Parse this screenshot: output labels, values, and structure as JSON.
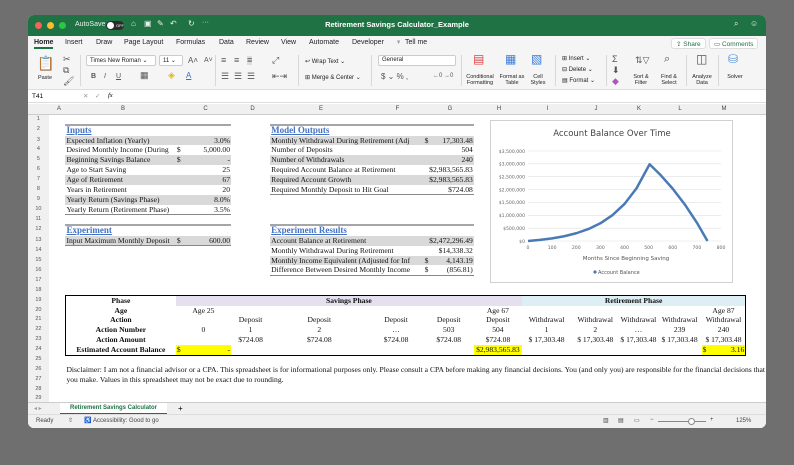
{
  "titlebar": {
    "autosave_label": "AutoSave",
    "autosave_state": "OFF",
    "title": "Retirement Savings Calculator_Example"
  },
  "menu": {
    "tabs": [
      "Home",
      "Insert",
      "Draw",
      "Page Layout",
      "Formulas",
      "Data",
      "Review",
      "View",
      "Automate",
      "Developer",
      "Tell me"
    ],
    "share": "Share",
    "comments": "Comments"
  },
  "ribbon": {
    "paste": "Paste",
    "font_name": "Times New Roman",
    "font_size": "11",
    "wrap_text": "Wrap Text",
    "merge_center": "Merge & Center",
    "number_format": "General",
    "conditional_formatting": "Conditional Formatting",
    "format_as_table": "Format as Table",
    "cell_styles": "Cell Styles",
    "insert": "Insert",
    "delete": "Delete",
    "format": "Format",
    "sort_filter": "Sort & Filter",
    "find_select": "Find & Select",
    "analyze_data": "Analyze Data",
    "solver": "Solver"
  },
  "formula_bar": {
    "name_box": "T41",
    "fx": "fx",
    "value": ""
  },
  "columns": [
    "A",
    "B",
    "C",
    "D",
    "E",
    "F",
    "G",
    "H",
    "I",
    "J",
    "K",
    "L",
    "M"
  ],
  "rows": [
    "1",
    "2",
    "3",
    "4",
    "5",
    "6",
    "7",
    "8",
    "9",
    "10",
    "11",
    "12",
    "13",
    "14",
    "15",
    "16",
    "17",
    "18",
    "19",
    "20",
    "21",
    "22",
    "23",
    "24",
    "25",
    "26",
    "27",
    "28",
    "29"
  ],
  "inputs": {
    "title": "Inputs",
    "rows": [
      {
        "label": "Expected Inflation (Yearly)",
        "cur": "",
        "value": "3.0%"
      },
      {
        "label": "Desired Monthly Income (During",
        "cur": "$",
        "value": "5,000.00"
      },
      {
        "label": "Beginning Savings Balance",
        "cur": "$",
        "value": "-"
      },
      {
        "label": "Age to Start Saving",
        "cur": "",
        "value": "25"
      },
      {
        "label": "Age of Retirement",
        "cur": "",
        "value": "67"
      },
      {
        "label": "Years in Retirement",
        "cur": "",
        "value": "20"
      },
      {
        "label": "Yearly Return (Savings Phase)",
        "cur": "",
        "value": "8.0%"
      },
      {
        "label": "Yearly Return (Retirement Phase)",
        "cur": "",
        "value": "3.5%"
      }
    ]
  },
  "outputs": {
    "title": "Model Outputs",
    "rows": [
      {
        "label": "Monthly Withdrawal During Retirement (Adj",
        "cur": "$",
        "value": "17,303.48"
      },
      {
        "label": "Number of Deposits",
        "cur": "",
        "value": "504"
      },
      {
        "label": "Number of Withdrawals",
        "cur": "",
        "value": "240"
      },
      {
        "label": "Required Account Balance at Retirement",
        "cur": "",
        "value": "$2,983,565.83"
      },
      {
        "label": "Required Account Growth",
        "cur": "",
        "value": "$2,983,565.83"
      },
      {
        "label": "Required Monthly Deposit to Hit Goal",
        "cur": "",
        "value": "$724.08"
      }
    ]
  },
  "experiment": {
    "title": "Experiment",
    "rows": [
      {
        "label": "Input Maximum Monthly Deposit",
        "cur": "$",
        "value": "600.00"
      }
    ]
  },
  "experiment_results": {
    "title": "Experiment Results",
    "rows": [
      {
        "label": "Account Balance at Retirement",
        "cur": "",
        "value": "$2,472,296.49"
      },
      {
        "label": "Monthly Withdrawal During Retirement",
        "cur": "",
        "value": "$14,338.32"
      },
      {
        "label": "Monthly Income Equivalent (Adjusted for Inf",
        "cur": "$",
        "value": "4,143.19"
      },
      {
        "label": "Difference Between Desired Monthly Income",
        "cur": "$",
        "value": "(856.81)"
      }
    ]
  },
  "phase_table": {
    "labels": [
      "Phase",
      "Age",
      "Action",
      "Action Number",
      "Action Amount",
      "Estimated Account Balance"
    ],
    "savings_phase": "Savings Phase",
    "retirement_phase": "Retirement Phase",
    "ages": {
      "C": "Age 25",
      "H": "Age 67",
      "M": "Age 87"
    },
    "actions": [
      "",
      "Deposit",
      "Deposit",
      "Deposit",
      "Deposit",
      "Deposit",
      "Withdrawal",
      "Withdrawal",
      "Withdrawal",
      "Withdrawal",
      "Withdrawal"
    ],
    "numbers": [
      "0",
      "1",
      "2",
      "…",
      "503",
      "504",
      "1",
      "2",
      "…",
      "239",
      "240"
    ],
    "amounts": [
      "",
      "$724.08",
      "$724.08",
      "$724.08",
      "$724.08",
      "$724.08",
      "$ 17,303.48",
      "$ 17,303.48",
      "$ 17,303.48",
      "$ 17,303.48",
      "$ 17,303.48"
    ],
    "balance_start": {
      "cur": "$",
      "value": "-"
    },
    "balance_retirement": "$2,983,565.83",
    "balance_end": {
      "cur": "$",
      "value": "3.16"
    }
  },
  "disclaimer": [
    "Disclaimer: I am not a financial advisor or a CPA. This spreadsheet is for informational purposes only. Please consult a CPA before making any financial decisions. You (and only you) are responsible for the financial decisions that",
    "you make. Values in this spreadsheet may not be exact due to rounding."
  ],
  "sheet_tabs": {
    "active": "Retirement Savings Calculator",
    "add": "+"
  },
  "status": {
    "ready": "Ready",
    "accessibility": "Accessibility: Good to go",
    "zoom": "125%"
  },
  "chart_data": {
    "type": "line",
    "title": "Account Balance Over Time",
    "xlabel": "Months Since Beginning Saving",
    "ylabel": "",
    "legend": "Account Balance",
    "legend_position": "bottom",
    "color": "#4a7ab5",
    "xlim": [
      0,
      800
    ],
    "ylim": [
      0,
      3500000
    ],
    "xticks": [
      0,
      100,
      200,
      300,
      400,
      500,
      600,
      700,
      800
    ],
    "yticks": [
      0,
      500000,
      1000000,
      1500000,
      2000000,
      2500000,
      3000000,
      3500000
    ],
    "ytick_labels": [
      "$0",
      "$500,000",
      "$1,000,000",
      "$1,500,000",
      "$2,000,000",
      "$2,500,000",
      "$3,000,000",
      "$3,500,000"
    ],
    "x": [
      0,
      50,
      100,
      150,
      200,
      250,
      300,
      350,
      400,
      450,
      504,
      550,
      600,
      650,
      700,
      744
    ],
    "y": [
      0,
      42800,
      102500,
      185600,
      301600,
      463200,
      688600,
      1002800,
      1440700,
      2051000,
      2983566,
      2560600,
      2032300,
      1420500,
      713900,
      3
    ]
  }
}
